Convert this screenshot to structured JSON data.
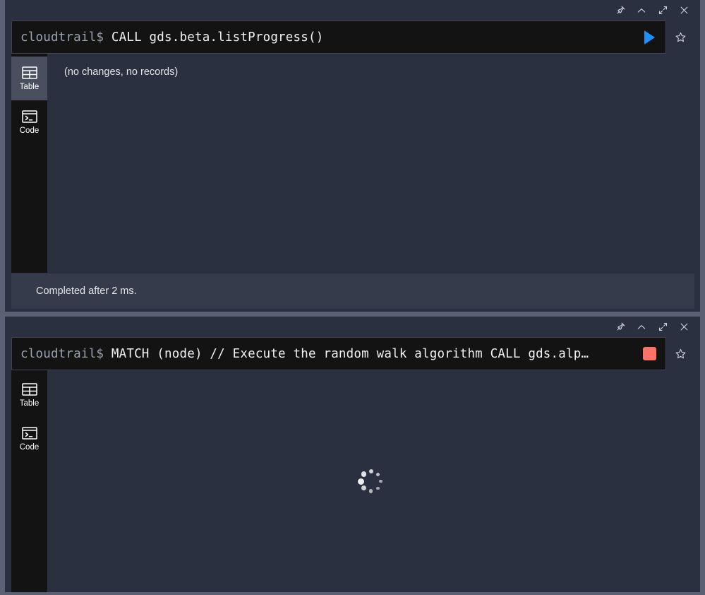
{
  "window": {
    "background_color": "#5b6073",
    "panel_color": "#2b3040"
  },
  "titlebar_buttons": [
    {
      "name": "pin-icon",
      "label": "Pin"
    },
    {
      "name": "chevron-up-icon",
      "label": "Collapse"
    },
    {
      "name": "expand-icon",
      "label": "Expand"
    },
    {
      "name": "close-icon",
      "label": "Close"
    }
  ],
  "panels": [
    {
      "id": "panel-completed",
      "query": {
        "prompt": "cloudtrail$",
        "command": "CALL gds.beta.listProgress()",
        "full_text": "cloudtrail$ CALL gds.beta.listProgress()"
      },
      "run_button": {
        "name": "run-query-button",
        "state": "idle",
        "icon": "play-icon",
        "color": "#1e90ff"
      },
      "favorite_button": {
        "name": "favorite-star-icon",
        "state": "off"
      },
      "sidebar_tabs": [
        {
          "label": "Table",
          "icon": "table-icon",
          "active": true
        },
        {
          "label": "Code",
          "icon": "code-terminal-icon",
          "active": false
        }
      ],
      "result": {
        "type": "message",
        "text": "(no changes, no records)"
      },
      "status": "Completed after 2 ms."
    },
    {
      "id": "panel-running",
      "query": {
        "prompt": "cloudtrail$",
        "command": "MATCH (node) // Execute the random walk algorithm CALL gds.alp…",
        "full_text": "cloudtrail$ MATCH (node) // Execute the random walk algorithm CALL gds.alp…"
      },
      "run_button": {
        "name": "stop-query-button",
        "state": "running",
        "icon": "stop-icon",
        "color": "#fa7268"
      },
      "favorite_button": {
        "name": "favorite-star-icon",
        "state": "off"
      },
      "sidebar_tabs": [
        {
          "label": "Table",
          "icon": "table-icon",
          "active": false
        },
        {
          "label": "Code",
          "icon": "code-terminal-icon",
          "active": false
        }
      ],
      "result": {
        "type": "loading",
        "text": ""
      },
      "status": ""
    }
  ]
}
